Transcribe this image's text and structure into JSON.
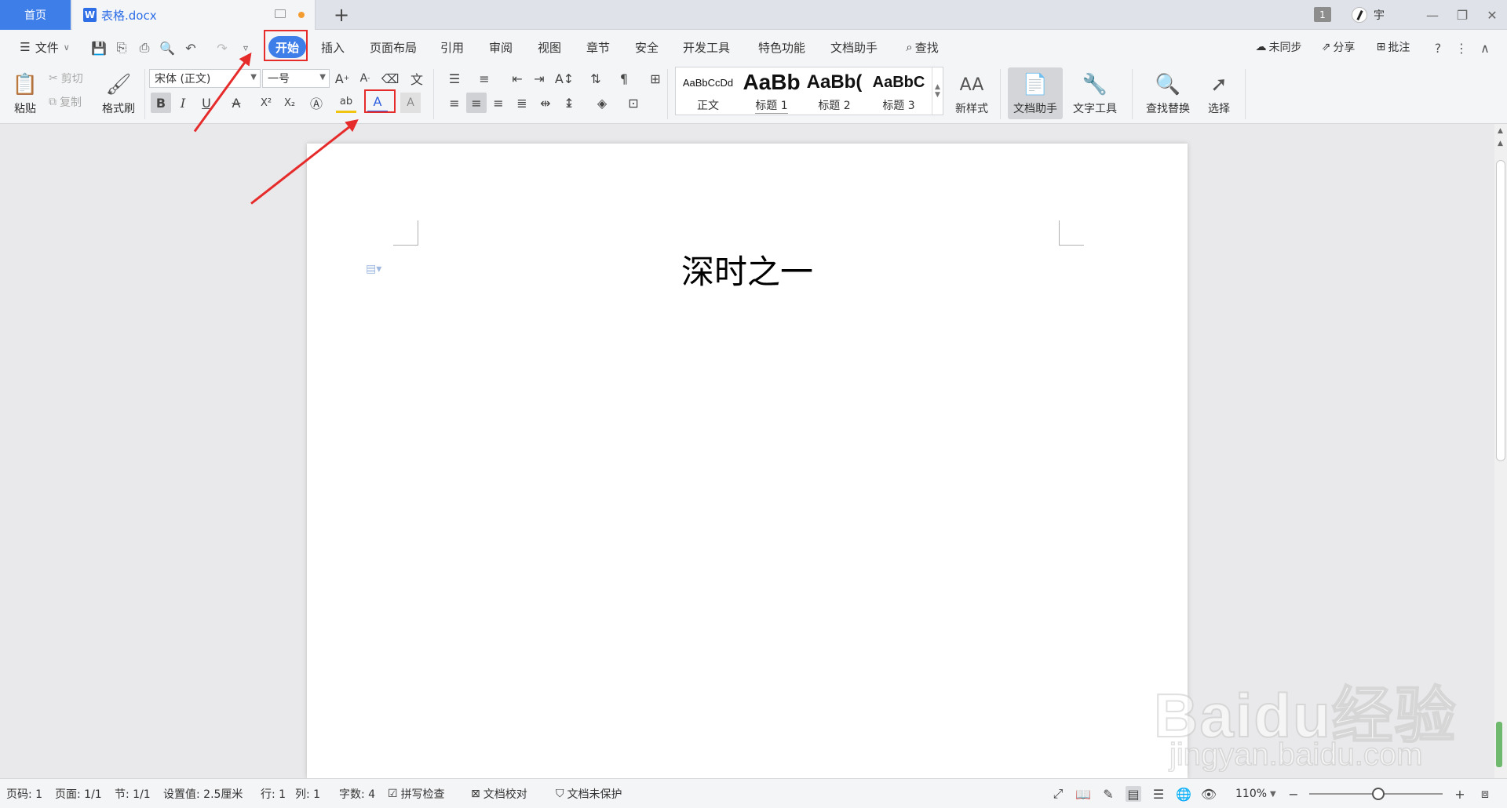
{
  "tabs": {
    "home": "首页",
    "document": "表格.docx",
    "document_icon": "W",
    "new_tab": "+",
    "window_count": "1",
    "user_name": "宇"
  },
  "menu": {
    "file": "文件",
    "items": [
      "开始",
      "插入",
      "页面布局",
      "引用",
      "审阅",
      "视图",
      "章节",
      "安全",
      "开发工具",
      "特色功能",
      "文档助手",
      "查找"
    ],
    "active": "开始",
    "right": {
      "sync": "未同步",
      "share": "分享",
      "comment": "批注"
    }
  },
  "ribbon": {
    "paste": "粘贴",
    "cut": "剪切",
    "copy": "复制",
    "format_painter": "格式刷",
    "font_name": "宋体 (正文)",
    "font_size": "一号",
    "styles": [
      {
        "sample": "AaBbCcDd",
        "name": "正文"
      },
      {
        "sample": "AaBb",
        "name": "标题 1"
      },
      {
        "sample": "AaBb(",
        "name": "标题 2"
      },
      {
        "sample": "AaBbC",
        "name": "标题 3"
      }
    ],
    "new_style": "新样式",
    "doc_assistant": "文档助手",
    "text_tools": "文字工具",
    "find_replace": "查找替换",
    "select": "选择"
  },
  "document": {
    "title_text": "深时之一"
  },
  "status": {
    "page_num": "页码: 1",
    "pages": "页面: 1/1",
    "section": "节: 1/1",
    "setting": "设置值: 2.5厘米",
    "row": "行: 1",
    "col": "列: 1",
    "word_count": "字数: 4",
    "spell_check": "拼写检查",
    "doc_proof": "文档校对",
    "doc_protect": "文档未保护",
    "zoom": "110%"
  },
  "watermark": {
    "main": "Baidu经验",
    "sub": "jingyan.baidu.com"
  },
  "colors": {
    "accent": "#3e7ee8",
    "annotation": "#e62b2b"
  }
}
